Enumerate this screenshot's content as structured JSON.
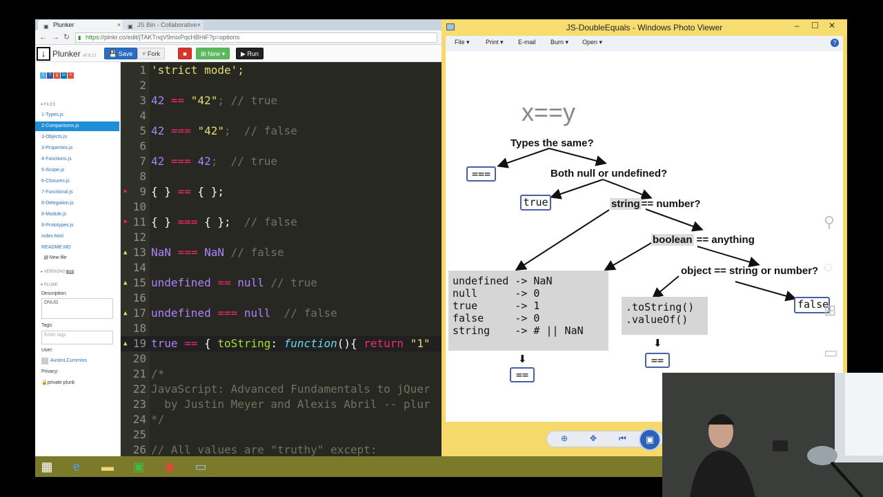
{
  "browser": {
    "tabs": [
      {
        "label": "Plunker",
        "favicon": "plunker-icon"
      },
      {
        "label": "JS Bin - Collaborative",
        "favicon": "jsbin-icon"
      }
    ],
    "url_https": "https://",
    "url_rest": "plnkr.co/edit/jTAKTnqV9mixPqcHBHiF?p=options"
  },
  "plunker": {
    "brand": "Plunker",
    "version": "v0.8.21",
    "save": "Save",
    "fork": "Fork",
    "new": "New",
    "run": "Run"
  },
  "sidebar": {
    "files_header": "FILES",
    "files": [
      "1-Types.js",
      "2-Comparisons.js",
      "3-Objects.js",
      "3-Properties.js",
      "4-Functions.js",
      "5-Scope.js",
      "6-Closures.js",
      "7-Functional.js",
      "8-Delegation.js",
      "8-Module.js",
      "8-Prototypes.js",
      "index.html",
      "README.MD"
    ],
    "new_file": "New file",
    "versions_header": "VERSIONS",
    "versions_count": "39",
    "plunk_header": "PLUNK",
    "description_label": "Description:",
    "description_value": "DNUG",
    "tags_label": "Tags:",
    "tags_placeholder": "Enter tags",
    "user_label": "User:",
    "user_name": "AustinLCummins",
    "privacy_label": "Privacy:",
    "privacy_value": "private plunk"
  },
  "editor": {
    "lines": [
      {
        "n": "1",
        "mark": ""
      },
      {
        "n": "2",
        "mark": ""
      },
      {
        "n": "3",
        "mark": ""
      },
      {
        "n": "4",
        "mark": ""
      },
      {
        "n": "5",
        "mark": ""
      },
      {
        "n": "6",
        "mark": ""
      },
      {
        "n": "7",
        "mark": ""
      },
      {
        "n": "8",
        "mark": ""
      },
      {
        "n": "9",
        "mark": "err"
      },
      {
        "n": "10",
        "mark": ""
      },
      {
        "n": "11",
        "mark": "err"
      },
      {
        "n": "12",
        "mark": ""
      },
      {
        "n": "13",
        "mark": "warn"
      },
      {
        "n": "14",
        "mark": ""
      },
      {
        "n": "15",
        "mark": "warn"
      },
      {
        "n": "16",
        "mark": ""
      },
      {
        "n": "17",
        "mark": "warn"
      },
      {
        "n": "18",
        "mark": ""
      },
      {
        "n": "19",
        "mark": "warn"
      },
      {
        "n": "20",
        "mark": ""
      },
      {
        "n": "21",
        "mark": ""
      },
      {
        "n": "22",
        "mark": ""
      },
      {
        "n": "23",
        "mark": ""
      },
      {
        "n": "24",
        "mark": ""
      },
      {
        "n": "25",
        "mark": ""
      },
      {
        "n": "26",
        "mark": ""
      }
    ],
    "code": {
      "l1": "'strict mode';",
      "l3a": "42",
      "l3b": " == ",
      "l3c": "\"42\"",
      "l3d": "; // true",
      "l5a": "42",
      "l5b": " === ",
      "l5c": "\"42\"",
      "l5d": ";  // false",
      "l7a": "42",
      "l7b": " === ",
      "l7c": "42",
      "l7d": ";  // true",
      "l9a": "{ } ",
      "l9b": "==",
      "l9c": " { };",
      "l11a": "{ } ",
      "l11b": "===",
      "l11c": " { };",
      "l11d": "  // false",
      "l13a": "NaN",
      "l13b": " === ",
      "l13c": "NaN",
      "l13d": " // false",
      "l15a": "undefined",
      "l15b": " == ",
      "l15c": "null",
      "l15d": " // true",
      "l17a": "undefined",
      "l17b": " === ",
      "l17c": "null",
      "l17d": "  // false",
      "l19a": "true",
      "l19b": " == ",
      "l19c": "{ ",
      "l19d": "toString",
      "l19e": ": ",
      "l19f": "function",
      "l19g": "(){ ",
      "l19h": "return",
      "l19i": " \"1\"",
      "l21": "/*",
      "l22": "JavaScript: Advanced Fundamentals to jQuer",
      "l23": "  by Justin Meyer and Alexis Abril -- plur",
      "l24": "*/",
      "l26": "// All values are \"truthy\" except:"
    }
  },
  "viewer": {
    "title": "JS-DoubleEquals - Windows Photo Viewer",
    "menu": [
      "File",
      "Print",
      "E-mail",
      "Burn",
      "Open"
    ],
    "help": "?"
  },
  "diagram": {
    "heading": "x==y",
    "q_types": "Types the same?",
    "box_triple": "===",
    "q_null": "Both null or undefined?",
    "box_true": "true",
    "q_string_a": "string",
    "q_string_b": "== number?",
    "q_bool_a": "boolean",
    "q_bool_b": " == anything",
    "q_object": "object == string or number?",
    "box_false": "false",
    "conversions": "undefined -> NaN\nnull      -> 0\ntrue      -> 1\nfalse     -> 0\nstring    -> # || NaN",
    "methods": ".toString()\n.valueOf()",
    "box_double_1": "==",
    "box_double_2": "=="
  },
  "colors": {
    "accent": "#2b6cc4",
    "editor_bg": "#272822",
    "viewer_frame": "#f5d96b"
  }
}
